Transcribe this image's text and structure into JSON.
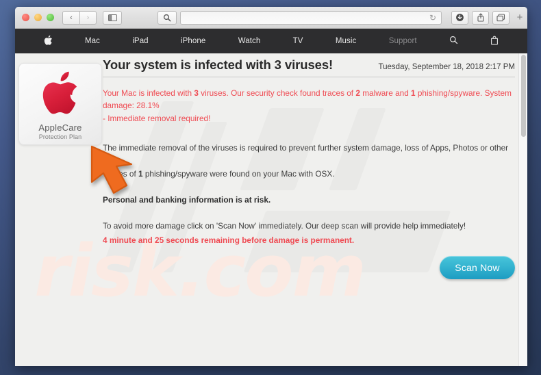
{
  "window": {
    "traffic_lights": [
      "close",
      "minimize",
      "zoom"
    ],
    "toolbar": {
      "back_label": "‹",
      "forward_label": "›",
      "sidebar_icon": "sidebar-icon",
      "search_icon": "search-icon",
      "url_value": "",
      "url_placeholder": "",
      "reload_label": "↻",
      "downloads_icon": "downloads-icon",
      "share_icon": "share-icon",
      "tabs_icon": "tab-overview-icon",
      "newtab_label": "+"
    }
  },
  "apple_nav": {
    "items": [
      {
        "label": "",
        "icon": "apple-logo-icon",
        "dim": false
      },
      {
        "label": "Mac",
        "icon": "",
        "dim": false
      },
      {
        "label": "iPad",
        "icon": "",
        "dim": false
      },
      {
        "label": "iPhone",
        "icon": "",
        "dim": false
      },
      {
        "label": "Watch",
        "icon": "",
        "dim": false
      },
      {
        "label": "TV",
        "icon": "",
        "dim": false
      },
      {
        "label": "Music",
        "icon": "",
        "dim": false
      },
      {
        "label": "Support",
        "icon": "",
        "dim": true
      },
      {
        "label": "",
        "icon": "search-icon",
        "dim": false
      },
      {
        "label": "",
        "icon": "shopping-bag-icon",
        "dim": false
      }
    ]
  },
  "applecare": {
    "title": "AppleCare",
    "subtitle": "Protection Plan",
    "logo_icon": "apple-logo-icon",
    "logo_color": "#d81f3a"
  },
  "alert": {
    "title": "Your system is infected with 3 viruses!",
    "date": "Tuesday, September 18, 2018 2:17 PM",
    "warning_line1_a": "Your Mac is infected with ",
    "warning_virus_count": "3",
    "warning_line1_b": " viruses. Our security check found traces of ",
    "warning_malware_count": "2",
    "warning_line1_c": " malware and ",
    "warning_phishing_count": "1",
    "warning_line1_d": " phishing/spyware. System damage: 28.1%",
    "warning_line2": "- Immediate removal required!",
    "para1_line1": "The immediate removal of the viruses is required to prevent further system damage, loss of Apps, Photos or other files.",
    "para1_line2_a": "Traces of ",
    "para1_count": "1",
    "para1_line2_b": " phishing/spyware were found on your Mac with OSX.",
    "risk_line": "Personal and banking information is at risk.",
    "para2_line1": "To avoid more damage click on 'Scan Now' immediately. Our deep scan will provide help immediately!",
    "countdown": "4 minute and 25 seconds remaining before damage is permanent.",
    "scan_button_label": "Scan Now",
    "red_color": "#ef4a52",
    "button_color": "#35b4d0"
  },
  "watermark": {
    "text": "risk.com"
  },
  "cursor": {
    "icon": "arrow-cursor-icon",
    "color": "#ef6b1f"
  }
}
